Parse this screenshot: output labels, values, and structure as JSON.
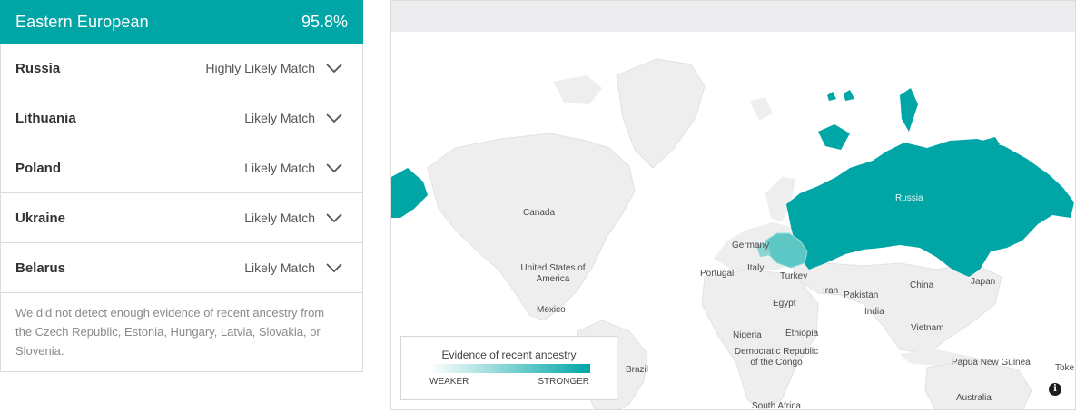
{
  "region": {
    "name": "Eastern European",
    "percent": "95.8%"
  },
  "countries": [
    {
      "name": "Russia",
      "match": "Highly Likely Match"
    },
    {
      "name": "Lithuania",
      "match": "Likely Match"
    },
    {
      "name": "Poland",
      "match": "Likely Match"
    },
    {
      "name": "Ukraine",
      "match": "Likely Match"
    },
    {
      "name": "Belarus",
      "match": "Likely Match"
    }
  ],
  "note": "We did not detect enough evidence of recent ancestry from the Czech Republic, Estonia, Hungary, Latvia, Slovakia, or Slovenia.",
  "map": {
    "labels": {
      "canada": "Canada",
      "usa": "United States of America",
      "mexico": "Mexico",
      "brazil": "Brazil",
      "russia": "Russia",
      "germany": "Germany",
      "portugal": "Portugal",
      "italy": "Italy",
      "turkey": "Turkey",
      "egypt": "Egypt",
      "iran": "Iran",
      "pakistan": "Pakistan",
      "india": "India",
      "china": "China",
      "japan": "Japan",
      "vietnam": "Vietnam",
      "nigeria": "Nigeria",
      "ethiopia": "Ethiopia",
      "drc": "Democratic Republic of the Congo",
      "png": "Papua New Guinea",
      "south_africa": "South Africa",
      "australia": "Australia",
      "tokelau": "Toke"
    },
    "legend": {
      "title": "Evidence of recent ancestry",
      "weaker": "WEAKER",
      "stronger": "STRONGER"
    },
    "colors": {
      "accent": "#00a5a6",
      "land": "#eeeeef",
      "highlight_light": "#5cc7c5"
    },
    "info_icon": "info-icon"
  }
}
